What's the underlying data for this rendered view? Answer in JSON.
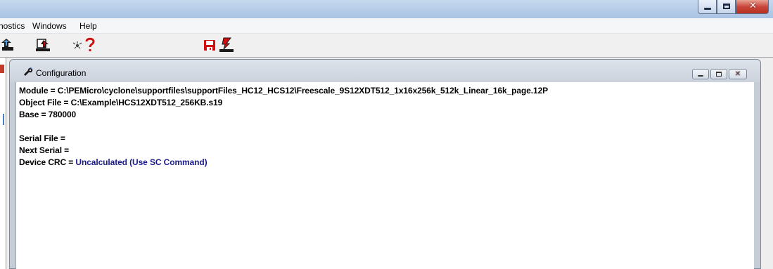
{
  "menubar": {
    "items": [
      "nostics",
      "Windows",
      "Help"
    ]
  },
  "toolbar": {
    "icons": [
      "nav-icon",
      "open-image-icon",
      "eye-icon",
      "help-icon",
      "save-icon",
      "program-icon"
    ],
    "colors": {
      "red": "#d01010",
      "dark": "#1a1a1a"
    }
  },
  "window": {
    "title": "Configuration"
  },
  "config": {
    "module_label": "Module = ",
    "module_value": "C:\\PEMicro\\cyclone\\supportfiles\\supportFiles_HC12_HCS12\\Freescale_9S12XDT512_1x16x256k_512k_Linear_16k_page.12P",
    "object_label": "Object File = ",
    "object_value": "C:\\Example\\HCS12XDT512_256KB.s19",
    "base_label": "Base = ",
    "base_value": "780000",
    "serial_file_label": "Serial File =",
    "next_serial_label": "Next Serial =",
    "crc_label": "Device CRC = ",
    "crc_value": "Uncalculated (Use SC Command)",
    "crc_value_color": "#1a1a8c"
  }
}
